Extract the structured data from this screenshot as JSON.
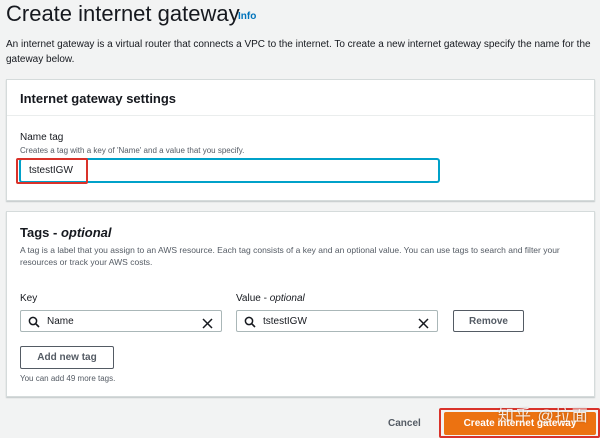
{
  "header": {
    "title": "Create internet gateway",
    "info_label": "Info",
    "description": "An internet gateway is a virtual router that connects a VPC to the internet. To create a new internet gateway specify the name for the gateway below."
  },
  "settings_panel": {
    "title": "Internet gateway settings",
    "name_tag_label": "Name tag",
    "name_tag_hint": "Creates a tag with a key of 'Name' and a value that you specify.",
    "name_tag_value": "tstestIGW"
  },
  "tags_panel": {
    "title": "Tags",
    "title_suffix": "optional",
    "description": "A tag is a label that you assign to an AWS resource. Each tag consists of a key and an optional value. You can use tags to search and filter your resources or track your AWS costs.",
    "key_header": "Key",
    "value_header": "Value",
    "value_header_suffix": "optional",
    "rows": [
      {
        "key": "Name",
        "value": "tstestIGW",
        "remove_label": "Remove"
      }
    ],
    "add_label": "Add new tag",
    "remaining_text": "You can add 49 more tags."
  },
  "footer": {
    "cancel_label": "Cancel",
    "submit_label": "Create internet gateway"
  },
  "watermark": "知乎 @拉面",
  "colors": {
    "primary": "#ec7211",
    "link": "#0073bb",
    "focus": "#00a1c9",
    "highlight": "#d9322a"
  }
}
